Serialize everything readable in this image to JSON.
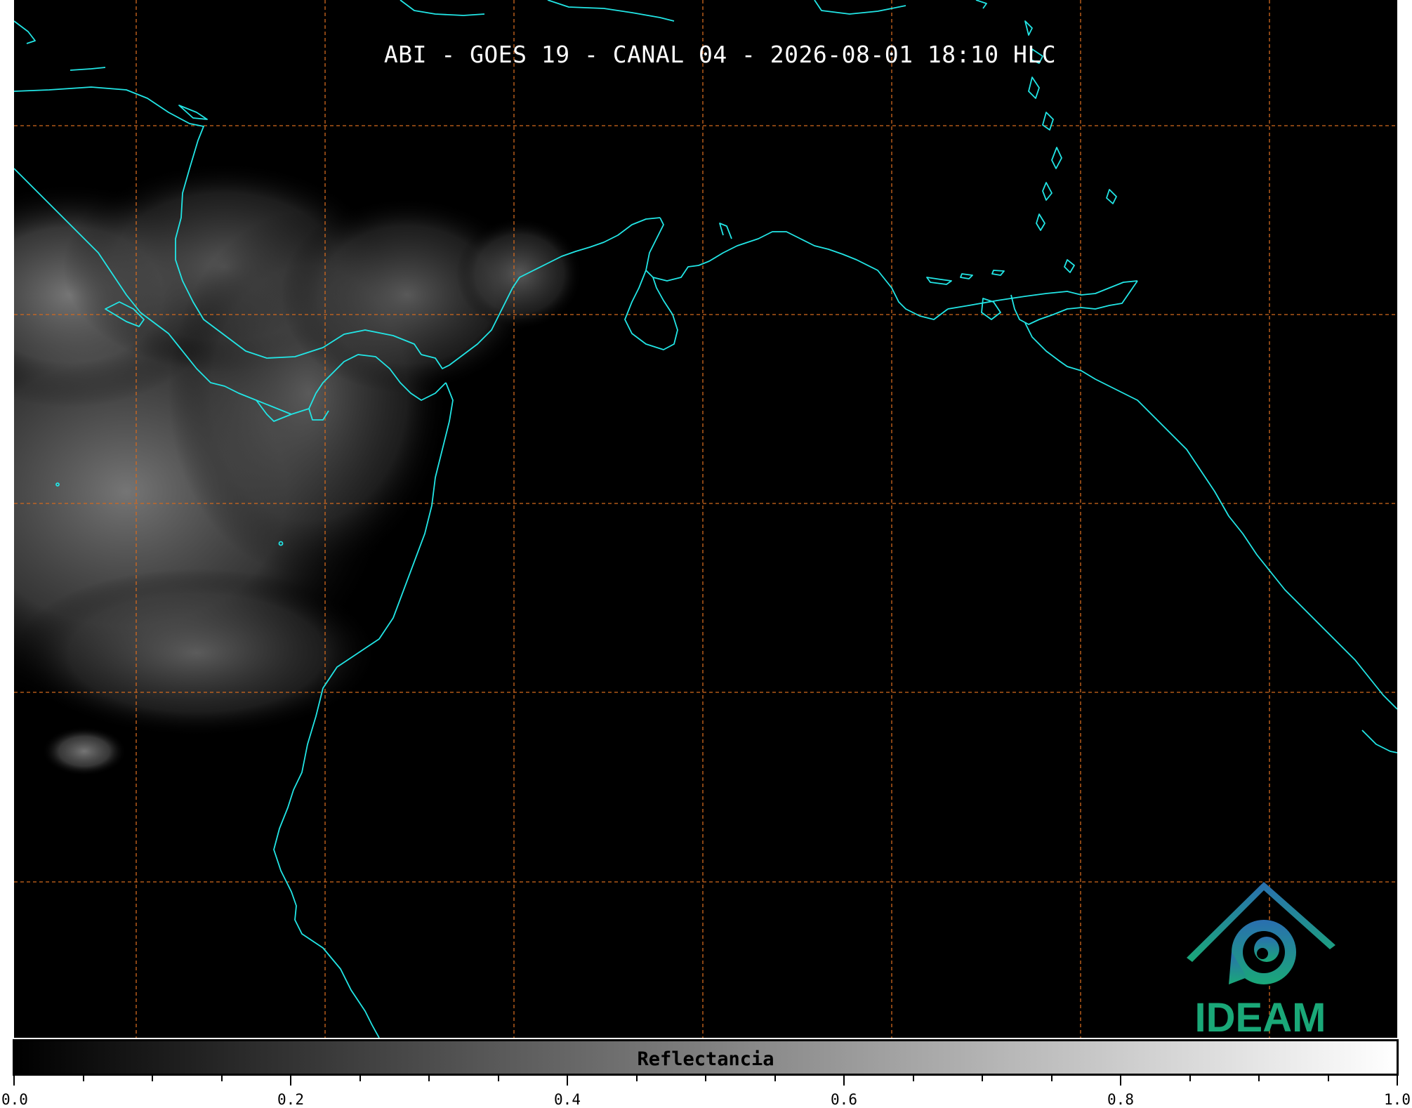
{
  "title": "ABI - GOES 19 - CANAL 04 - 2026-08-01 18:10 HLC",
  "colors": {
    "background": "#000000",
    "coastline": "#22e6e6",
    "graticule": "#d2691e",
    "logo_blue": "#2a6fb0",
    "logo_green": "#1aa878"
  },
  "logo": {
    "text": "IDEAM"
  },
  "colorbar": {
    "label": "Reflectancia",
    "range": [
      0.0,
      1.0
    ],
    "colormap": "grayscale black-to-white",
    "ticks": [
      {
        "value": 0.0,
        "label": "0.0"
      },
      {
        "value": 0.2,
        "label": "0.2"
      },
      {
        "value": 0.4,
        "label": "0.4"
      },
      {
        "value": 0.6,
        "label": "0.6"
      },
      {
        "value": 0.8,
        "label": "0.8"
      },
      {
        "value": 1.0,
        "label": "1.0"
      }
    ],
    "minor_ticks": [
      0.05,
      0.1,
      0.15,
      0.25,
      0.3,
      0.35,
      0.45,
      0.5,
      0.55,
      0.65,
      0.7,
      0.75,
      0.85,
      0.9,
      0.95
    ]
  }
}
